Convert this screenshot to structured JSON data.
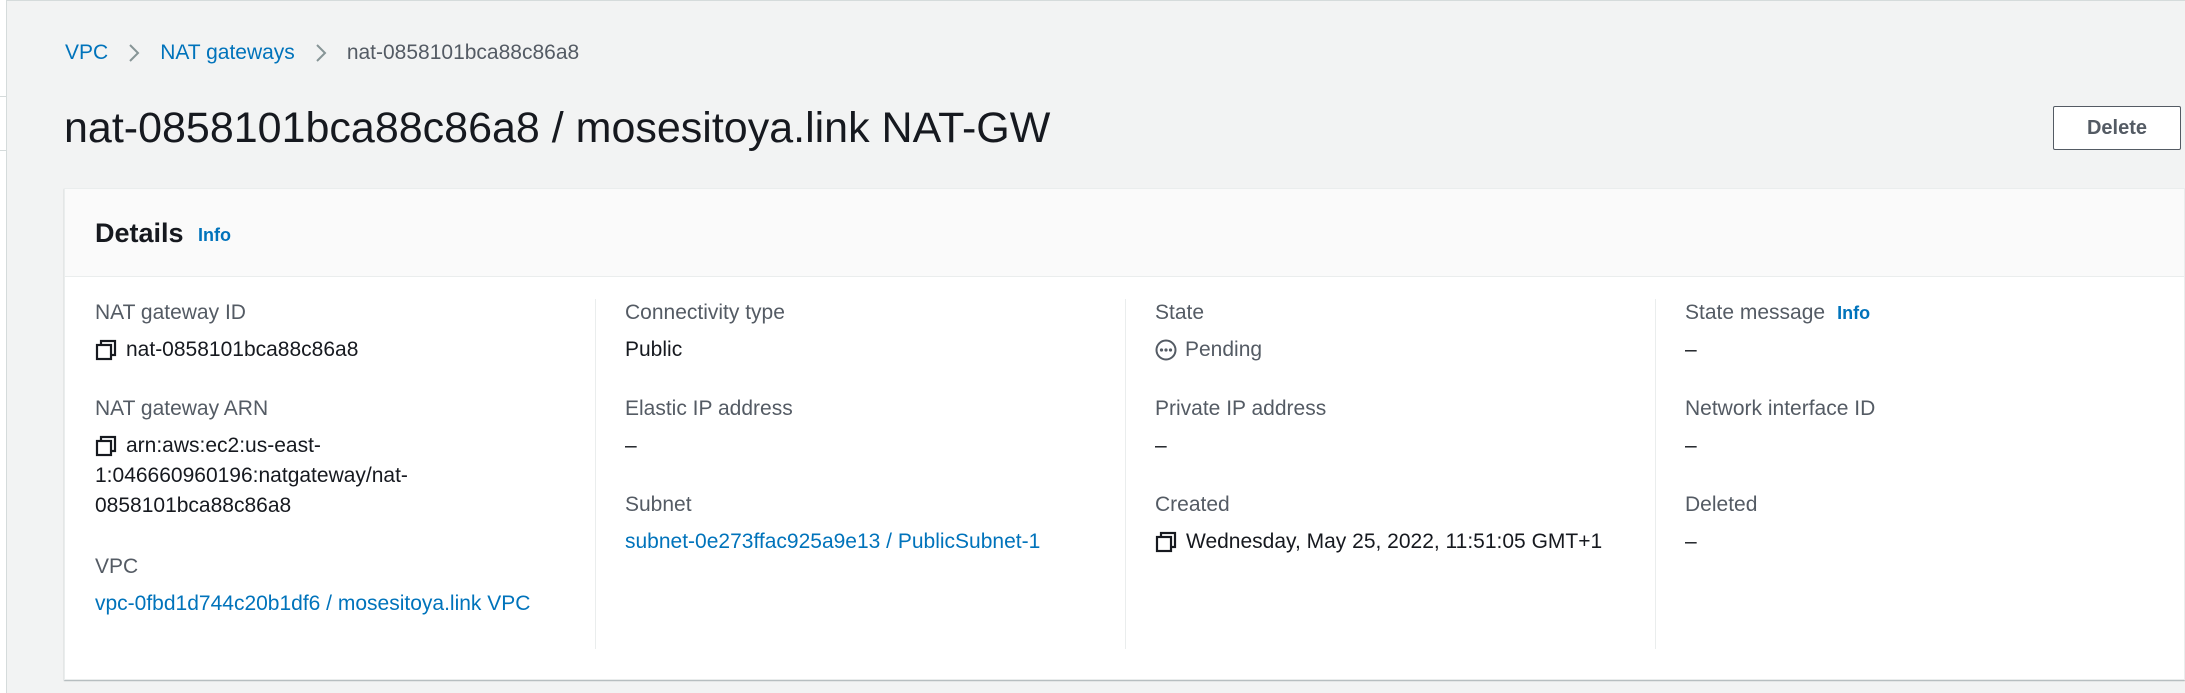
{
  "breadcrumb": {
    "vpc": "VPC",
    "nat_gateways": "NAT gateways",
    "current": "nat-0858101bca88c86a8"
  },
  "page_title": "nat-0858101bca88c86a8 / mosesitoya.link NAT-GW",
  "delete_label": "Delete",
  "details": {
    "title": "Details",
    "info": "Info",
    "col1": {
      "nat_gateway_id_label": "NAT gateway ID",
      "nat_gateway_id": "nat-0858101bca88c86a8",
      "nat_gateway_arn_label": "NAT gateway ARN",
      "nat_gateway_arn_line1": "arn:aws:ec2:us-east-",
      "nat_gateway_arn_line2": "1:046660960196:natgateway/nat-",
      "nat_gateway_arn_line3": "0858101bca88c86a8",
      "vpc_label": "VPC",
      "vpc": "vpc-0fbd1d744c20b1df6 / mosesitoya.link VPC"
    },
    "col2": {
      "connectivity_type_label": "Connectivity type",
      "connectivity_type": "Public",
      "elastic_ip_label": "Elastic IP address",
      "elastic_ip": "–",
      "subnet_label": "Subnet",
      "subnet": "subnet-0e273ffac925a9e13 / PublicSubnet-1"
    },
    "col3": {
      "state_label": "State",
      "state": "Pending",
      "private_ip_label": "Private IP address",
      "private_ip": "–",
      "created_label": "Created",
      "created": "Wednesday, May 25, 2022, 11:51:05 GMT+1"
    },
    "col4": {
      "state_message_label": "State message",
      "state_message_info": "Info",
      "state_message": "–",
      "network_interface_label": "Network interface ID",
      "network_interface": "–",
      "deleted_label": "Deleted",
      "deleted": "–"
    }
  },
  "colors": {
    "link": "#0073bb",
    "text": "#16191f",
    "label": "#545b64",
    "background": "#f2f3f3",
    "panel": "#ffffff"
  },
  "icons": {
    "copy": "copy-icon",
    "pending": "pending-icon",
    "breadcrumb_separator": "chevron-right-icon"
  }
}
